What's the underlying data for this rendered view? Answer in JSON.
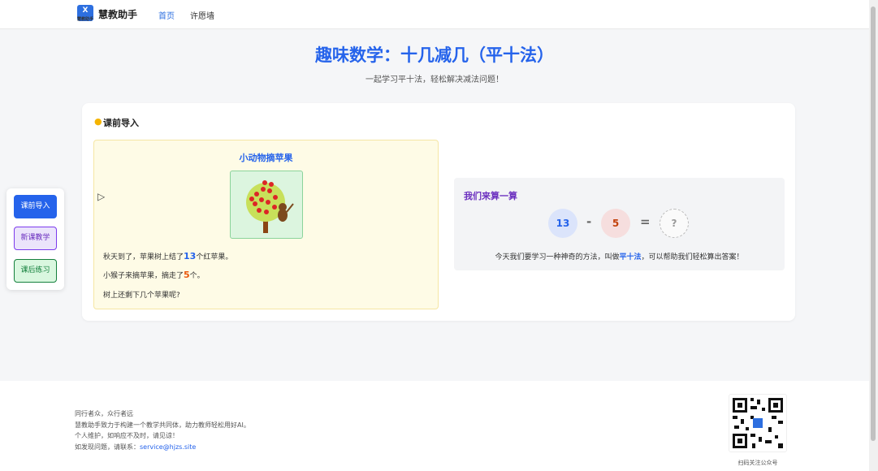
{
  "header": {
    "logo_text": "X",
    "logo_sub": "慧教助手",
    "brand": "慧教助手",
    "nav": [
      "首页",
      "许愿墙"
    ]
  },
  "page": {
    "title": "趣味数学：十几减几（平十法）",
    "subtitle": "一起学习平十法，轻松解决减法问题！"
  },
  "section": {
    "title": "课前导入",
    "story": {
      "title": "小动物摘苹果",
      "line1_pre": "秋天到了，苹果树上结了",
      "line1_num": "13",
      "line1_post": "个红苹果。",
      "line2_pre": "小猴子来摘苹果，摘走了",
      "line2_num": "5",
      "line2_post": "个。",
      "line3": "树上还剩下几个苹果呢?"
    },
    "calc": {
      "title": "我们来算一算",
      "a": "13",
      "op": "-",
      "b": "5",
      "eq": "=",
      "result": "?",
      "text_pre": "今天我们要学习一种神奇的方法，叫做",
      "text_strong": "平十法",
      "text_post": "，可以帮助我们轻松算出答案！"
    }
  },
  "sidenav": [
    "课前导入",
    "新课教学",
    "课后练习"
  ],
  "footer": {
    "lines": [
      "同行者众，众行者远",
      "慧教助手致力于构建一个教学共同体，助力教师轻松用好AI。",
      "个人维护，如响应不及时，请见谅！"
    ],
    "contact_pre": "如发现问题，请联系：",
    "contact_email": "service@hjzs.site",
    "qr_label": "扫码关注公众号"
  },
  "colors": {
    "accent": "#2563eb",
    "purple": "#6b2fbf",
    "green": "#15803d",
    "orange": "#ea580c"
  }
}
